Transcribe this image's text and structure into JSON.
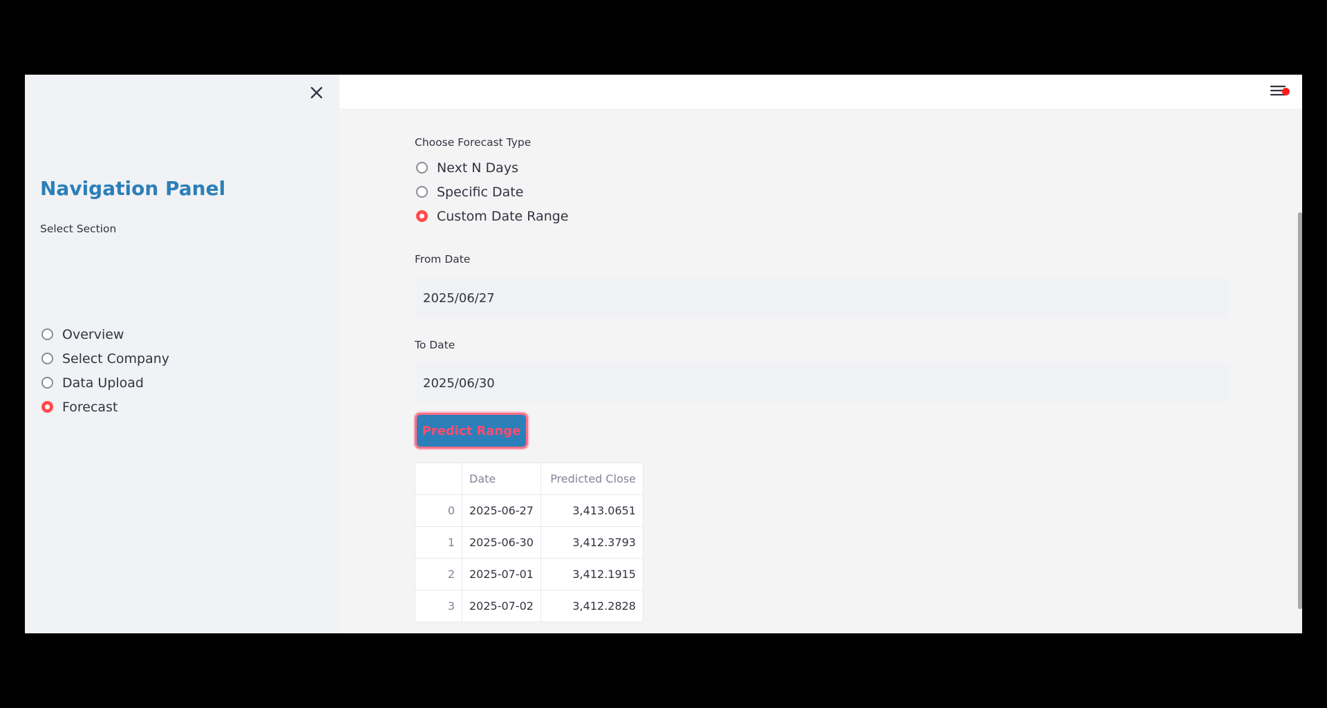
{
  "sidebar": {
    "title": "Navigation Panel",
    "section_label": "Select Section",
    "items": [
      {
        "label": "Overview",
        "selected": false
      },
      {
        "label": "Select Company",
        "selected": false
      },
      {
        "label": "Data Upload",
        "selected": false
      },
      {
        "label": "Forecast",
        "selected": true
      }
    ]
  },
  "forecast": {
    "type_label": "Choose Forecast Type",
    "types": [
      {
        "label": "Next N Days",
        "selected": false
      },
      {
        "label": "Specific Date",
        "selected": false
      },
      {
        "label": "Custom Date Range",
        "selected": true
      }
    ],
    "from_label": "From Date",
    "from_value": "2025/06/27",
    "to_label": "To Date",
    "to_value": "2025/06/30",
    "button_label": "Predict Range"
  },
  "table": {
    "headers": [
      "",
      "Date",
      "Predicted Close"
    ],
    "rows": [
      {
        "index": "0",
        "date": "2025-06-27",
        "close": "3,413.0651"
      },
      {
        "index": "1",
        "date": "2025-06-30",
        "close": "3,412.3793"
      },
      {
        "index": "2",
        "date": "2025-07-01",
        "close": "3,412.1915"
      },
      {
        "index": "3",
        "date": "2025-07-02",
        "close": "3,412.2828"
      }
    ]
  },
  "colors": {
    "accent": "#ff4b4b",
    "title_blue": "#2c7fb8",
    "button_bg": "#2c7fb8",
    "sidebar_bg": "#f1f2f5",
    "main_bg": "#f4f4f5"
  },
  "icons": {
    "close": "close-icon",
    "menu": "hamburger-menu-icon",
    "notification": "notification-dot-icon"
  }
}
